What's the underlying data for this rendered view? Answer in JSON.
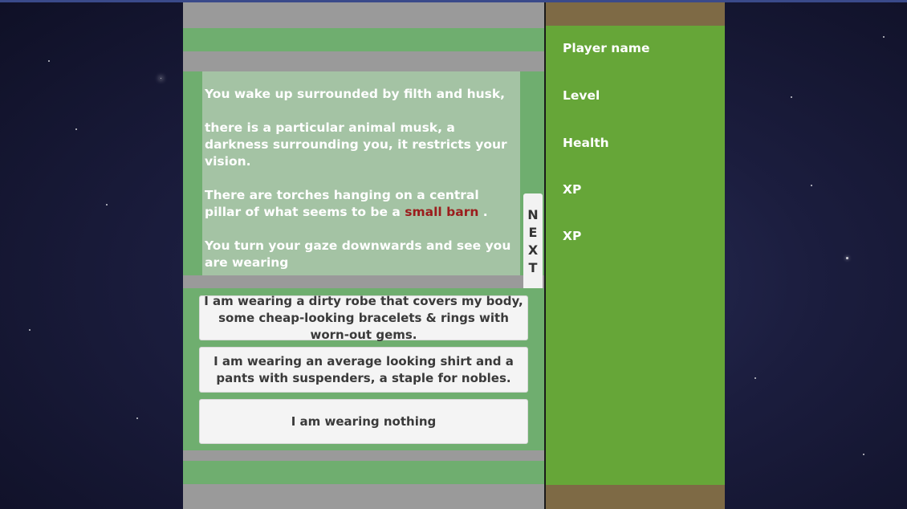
{
  "story": {
    "paragraph_1": "You wake up surrounded by filth and husk,",
    "paragraph_2": "there is a particular animal musk, a darkness surrounding you, it restricts your vision.",
    "paragraph_3_before": "There are torches hanging on a central pillar of what seems to be a ",
    "paragraph_3_link": "small barn",
    "paragraph_3_after": " .",
    "paragraph_4": "You turn your gaze downwards and see you are wearing"
  },
  "next_button": {
    "label": "NEXT"
  },
  "choices": [
    {
      "label": "I am wearing a dirty robe that covers my body, some cheap-looking bracelets & rings with worn-out gems."
    },
    {
      "label": "I am wearing an average looking shirt and a pants with suspenders, a staple for nobles."
    },
    {
      "label": "I am wearing nothing"
    }
  ],
  "stats": {
    "player_name": "Player name",
    "level": "Level",
    "health": "Health",
    "xp_1": "XP",
    "xp_2": "XP"
  },
  "colors": {
    "panel_green": "#6fae6f",
    "stats_green": "#66a638",
    "stats_frame": "#7e6a45",
    "link_red": "#9b1c1c",
    "panel_grey": "#9a9a9a"
  }
}
